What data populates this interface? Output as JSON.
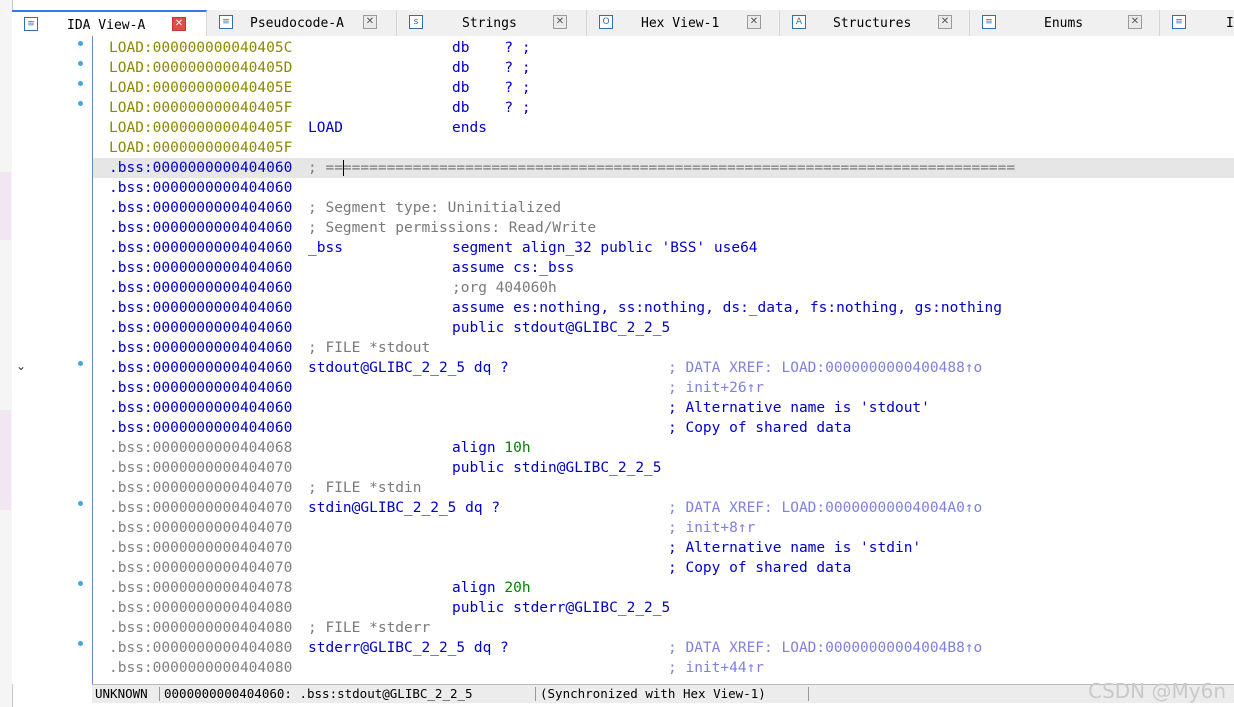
{
  "tabs": [
    {
      "label": "IDA View-A",
      "icon": "ida-view-icon",
      "active": true
    },
    {
      "label": "Pseudocode-A",
      "icon": "pseudocode-icon",
      "active": false
    },
    {
      "label": "Strings",
      "icon": "strings-icon",
      "active": false
    },
    {
      "label": "Hex View-1",
      "icon": "hex-view-icon",
      "active": false
    },
    {
      "label": "Structures",
      "icon": "structures-icon",
      "active": false
    },
    {
      "label": "Enums",
      "icon": "enums-icon",
      "active": false
    },
    {
      "label": "I",
      "icon": "imports-icon",
      "active": false
    }
  ],
  "tab_icon_glyphs": {
    "ida": "≡",
    "pseudo": "≡",
    "strings": "s",
    "hex": "O",
    "struct": "A",
    "enums": "≡",
    "imports": "≡"
  },
  "close_glyph": "✕",
  "disasm": {
    "lines": [
      {
        "addr": "LOAD:000000000040405C",
        "c2": "",
        "c3": "db    ? ;",
        "c4": ""
      },
      {
        "addr": "LOAD:000000000040405D",
        "c2": "",
        "c3": "db    ? ;",
        "c4": ""
      },
      {
        "addr": "LOAD:000000000040405E",
        "c2": "",
        "c3": "db    ? ;",
        "c4": ""
      },
      {
        "addr": "LOAD:000000000040405F",
        "c2": "",
        "c3": "db    ? ;",
        "c4": ""
      },
      {
        "addr": "LOAD:000000000040405F",
        "c2": "LOAD",
        "c3": "ends",
        "c4": ""
      },
      {
        "addr": "LOAD:000000000040405F",
        "c2": "",
        "c3": "",
        "c4": ""
      },
      {
        "addr": ".bss:0000000000404060",
        "c2": "; ===============================================================================",
        "c3": "",
        "c4": ""
      },
      {
        "addr": ".bss:0000000000404060",
        "c2": "",
        "c3": "",
        "c4": ""
      },
      {
        "addr": ".bss:0000000000404060",
        "c2": "; Segment type: Uninitialized",
        "c3": "",
        "c4": ""
      },
      {
        "addr": ".bss:0000000000404060",
        "c2": "; Segment permissions: Read/Write",
        "c3": "",
        "c4": ""
      },
      {
        "addr": ".bss:0000000000404060",
        "c2": "_bss",
        "c3": "segment align_32 public 'BSS' use64",
        "c4": ""
      },
      {
        "addr": ".bss:0000000000404060",
        "c2": "",
        "c3": "assume cs:_bss",
        "c4": ""
      },
      {
        "addr": ".bss:0000000000404060",
        "c2": "",
        "c3": ";org 404060h",
        "c4": ""
      },
      {
        "addr": ".bss:0000000000404060",
        "c2": "",
        "c3": "assume es:nothing, ss:nothing, ds:_data, fs:nothing, gs:nothing",
        "c4": ""
      },
      {
        "addr": ".bss:0000000000404060",
        "c2": "",
        "c3": "public stdout@GLIBC_2_2_5",
        "c4": ""
      },
      {
        "addr": ".bss:0000000000404060",
        "c2": "; FILE *stdout",
        "c3": "",
        "c4": ""
      },
      {
        "addr": ".bss:0000000000404060",
        "c2": "stdout@GLIBC_2_2_5 dq ?",
        "c3": "",
        "c4": "; DATA XREF: LOAD:0000000000400488↑o"
      },
      {
        "addr": ".bss:0000000000404060",
        "c2": "",
        "c3": "",
        "c4": "; init+26↑r"
      },
      {
        "addr": ".bss:0000000000404060",
        "c2": "",
        "c3": "",
        "c4": "; Alternative name is 'stdout'"
      },
      {
        "addr": ".bss:0000000000404060",
        "c2": "",
        "c3": "",
        "c4": "; Copy of shared data"
      },
      {
        "addr": ".bss:0000000000404068",
        "c2": "",
        "c3": "align 10h",
        "c4": ""
      },
      {
        "addr": ".bss:0000000000404070",
        "c2": "",
        "c3": "public stdin@GLIBC_2_2_5",
        "c4": ""
      },
      {
        "addr": ".bss:0000000000404070",
        "c2": "; FILE *stdin",
        "c3": "",
        "c4": ""
      },
      {
        "addr": ".bss:0000000000404070",
        "c2": "stdin@GLIBC_2_2_5 dq ?",
        "c3": "",
        "c4": "; DATA XREF: LOAD:00000000004004A0↑o"
      },
      {
        "addr": ".bss:0000000000404070",
        "c2": "",
        "c3": "",
        "c4": "; init+8↑r"
      },
      {
        "addr": ".bss:0000000000404070",
        "c2": "",
        "c3": "",
        "c4": "; Alternative name is 'stdin'"
      },
      {
        "addr": ".bss:0000000000404070",
        "c2": "",
        "c3": "",
        "c4": "; Copy of shared data"
      },
      {
        "addr": ".bss:0000000000404078",
        "c2": "",
        "c3": "align 20h",
        "c4": ""
      },
      {
        "addr": ".bss:0000000000404080",
        "c2": "",
        "c3": "public stderr@GLIBC_2_2_5",
        "c4": ""
      },
      {
        "addr": ".bss:0000000000404080",
        "c2": "; FILE *stderr",
        "c3": "",
        "c4": ""
      },
      {
        "addr": ".bss:0000000000404080",
        "c2": "stderr@GLIBC_2_2_5 dq ?",
        "c3": "",
        "c4": "; DATA XREF: LOAD:00000000004004B8↑o"
      },
      {
        "addr": ".bss:0000000000404080",
        "c2": "",
        "c3": "",
        "c4": "; init+44↑r"
      }
    ]
  },
  "status": {
    "mode": "UNKNOWN",
    "location": "0000000000404060: .bss:stdout@GLIBC_2_2_5",
    "sync": "(Synchronized with Hex View-1)"
  },
  "watermark": "CSDN @My6n",
  "colors": {
    "accent": "#3b78e7",
    "address_load": "#8a8a00",
    "address_bss_dark": "#0000c8",
    "xref": "#8080e0"
  }
}
